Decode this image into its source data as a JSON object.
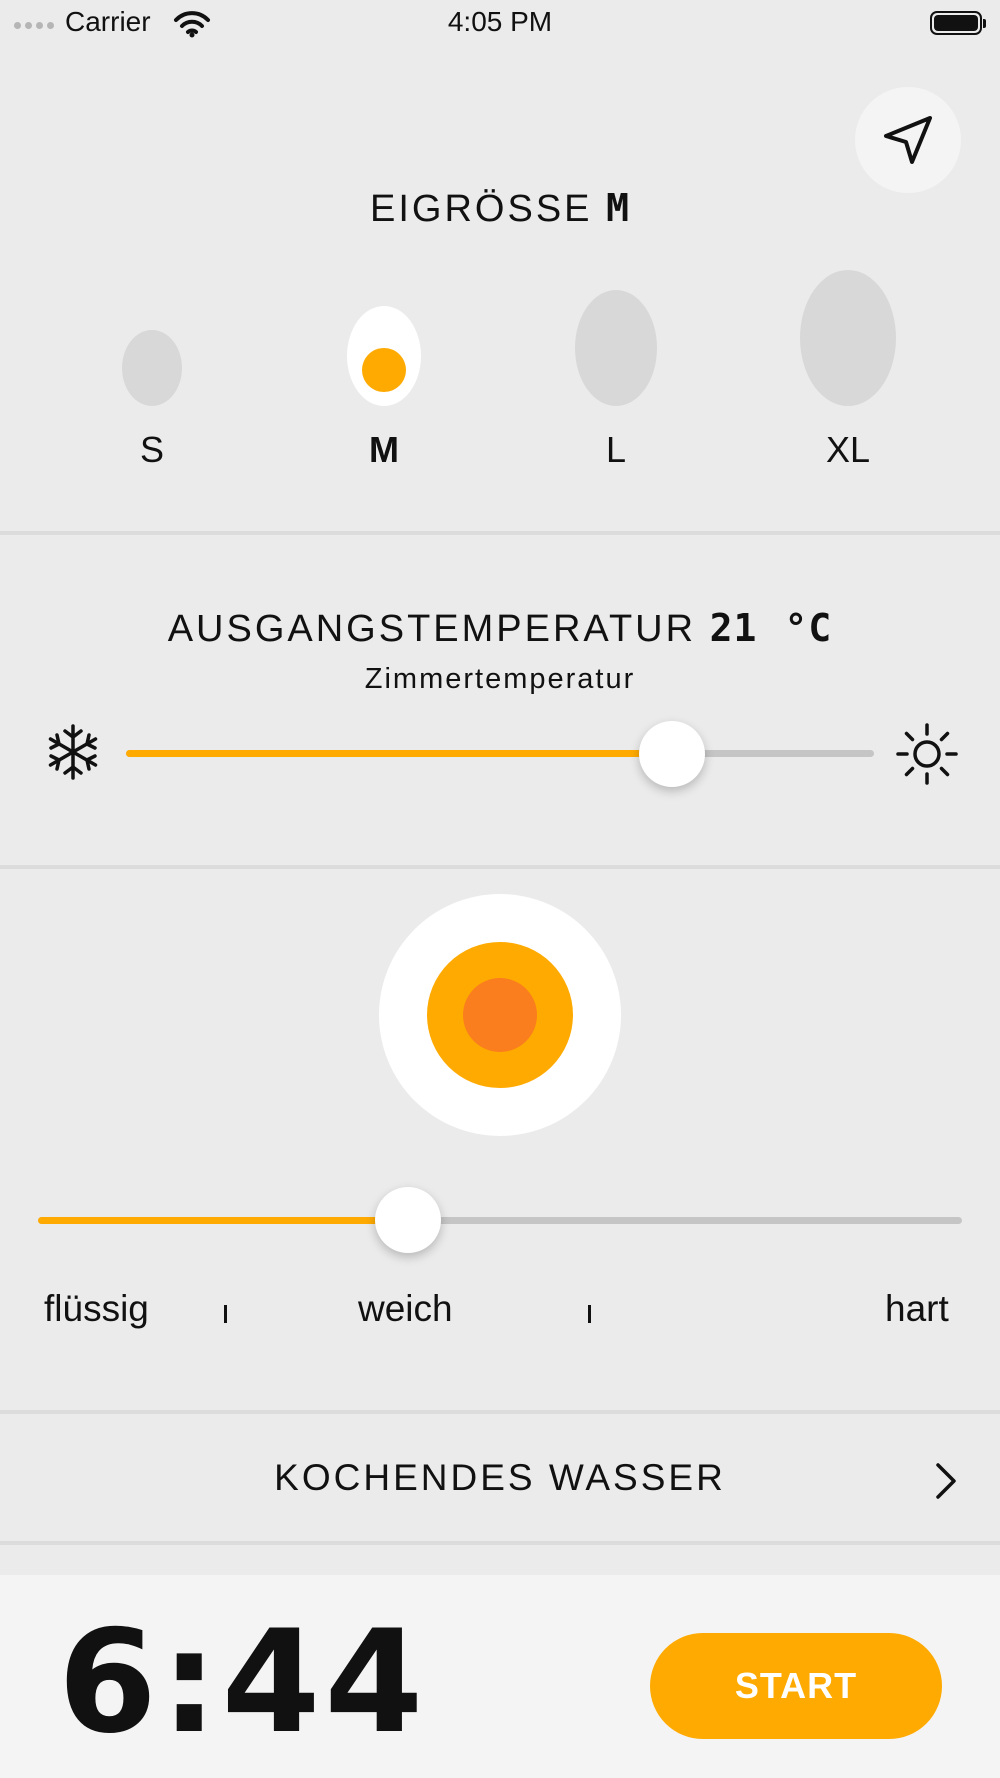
{
  "status_bar": {
    "carrier": "Carrier",
    "time": "4:05 PM"
  },
  "egg_size": {
    "title": "EIGRÖSSE",
    "selected": "M",
    "options": [
      "S",
      "M",
      "L",
      "XL"
    ]
  },
  "temperature": {
    "title": "AUSGANGSTEMPERATUR",
    "value": "21",
    "unit": "°C",
    "description": "Zimmertemperatur",
    "level": 0.73
  },
  "consistency": {
    "labels": [
      "flüssig",
      "weich",
      "hart"
    ],
    "level": 0.4
  },
  "water_row": {
    "label": "KOCHENDES WASSER"
  },
  "timer": {
    "minutes": "6",
    "separator": ":",
    "seconds": "44"
  },
  "start_button": {
    "label": "START"
  },
  "colors": {
    "accent": "#ffaa00",
    "yolk_inner": "#fb7e1e",
    "background": "#ebebeb"
  },
  "icons": [
    "signal-icon",
    "wifi-icon",
    "battery-icon",
    "navigation-arrow-icon",
    "snowflake-icon",
    "sun-icon",
    "chevron-right-icon"
  ]
}
